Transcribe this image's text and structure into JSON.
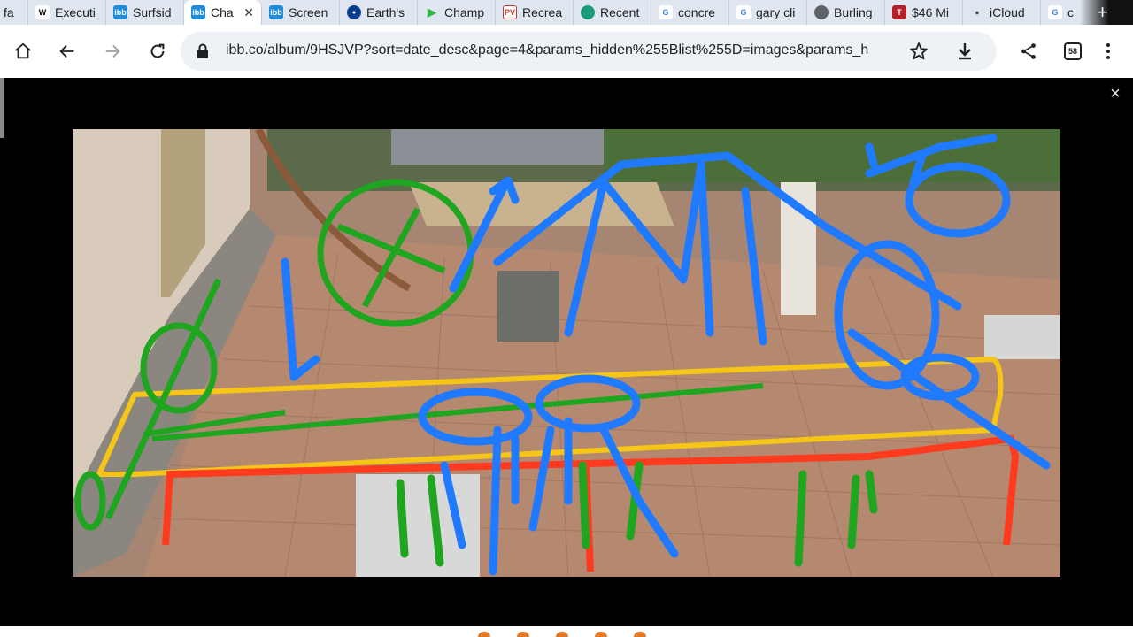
{
  "tabs": [
    {
      "label": "fa",
      "icon": "reddit-icon",
      "color": "#ff4500"
    },
    {
      "label": "Executi",
      "icon": "wikipedia-icon",
      "color": "#ffffff"
    },
    {
      "label": "Surfsid",
      "icon": "ibb-icon",
      "color": "#1f8ad8"
    },
    {
      "label": "Cha",
      "icon": "ibb-icon",
      "color": "#1f8ad8",
      "active": true
    },
    {
      "label": "Screen",
      "icon": "ibb-icon",
      "color": "#1f8ad8"
    },
    {
      "label": "Earth's",
      "icon": "nasa-icon",
      "color": "#0b3d91"
    },
    {
      "label": "Champ",
      "icon": "play-icon",
      "color": "#35b34a"
    },
    {
      "label": "Recrea",
      "icon": "pv-icon",
      "color": "#c0392b"
    },
    {
      "label": "Recent",
      "icon": "s-icon",
      "color": "#1a9c7b"
    },
    {
      "label": "concre",
      "icon": "google-icon",
      "color": "#4285f4"
    },
    {
      "label": "gary cli",
      "icon": "google-icon",
      "color": "#4285f4"
    },
    {
      "label": "Burling",
      "icon": "globe-icon",
      "color": "#5f6368"
    },
    {
      "label": "$46 Mi",
      "icon": "t-icon",
      "color": "#b3202a"
    },
    {
      "label": "iCloud",
      "icon": "apple-icon",
      "color": "#888888"
    },
    {
      "label": "c",
      "icon": "google-icon",
      "color": "#4285f4"
    }
  ],
  "toolbar": {
    "url": "ibb.co/album/9HSJVP?sort=date_desc&page=4&params_hidden%255Blist%255D=images&params_h",
    "tab_count": "58"
  },
  "viewer": {
    "close_label": "×"
  },
  "annotation_colors": {
    "blue": "#1f7aff",
    "green": "#1fa51f",
    "yellow": "#f5c518",
    "red": "#ff3b1f"
  }
}
